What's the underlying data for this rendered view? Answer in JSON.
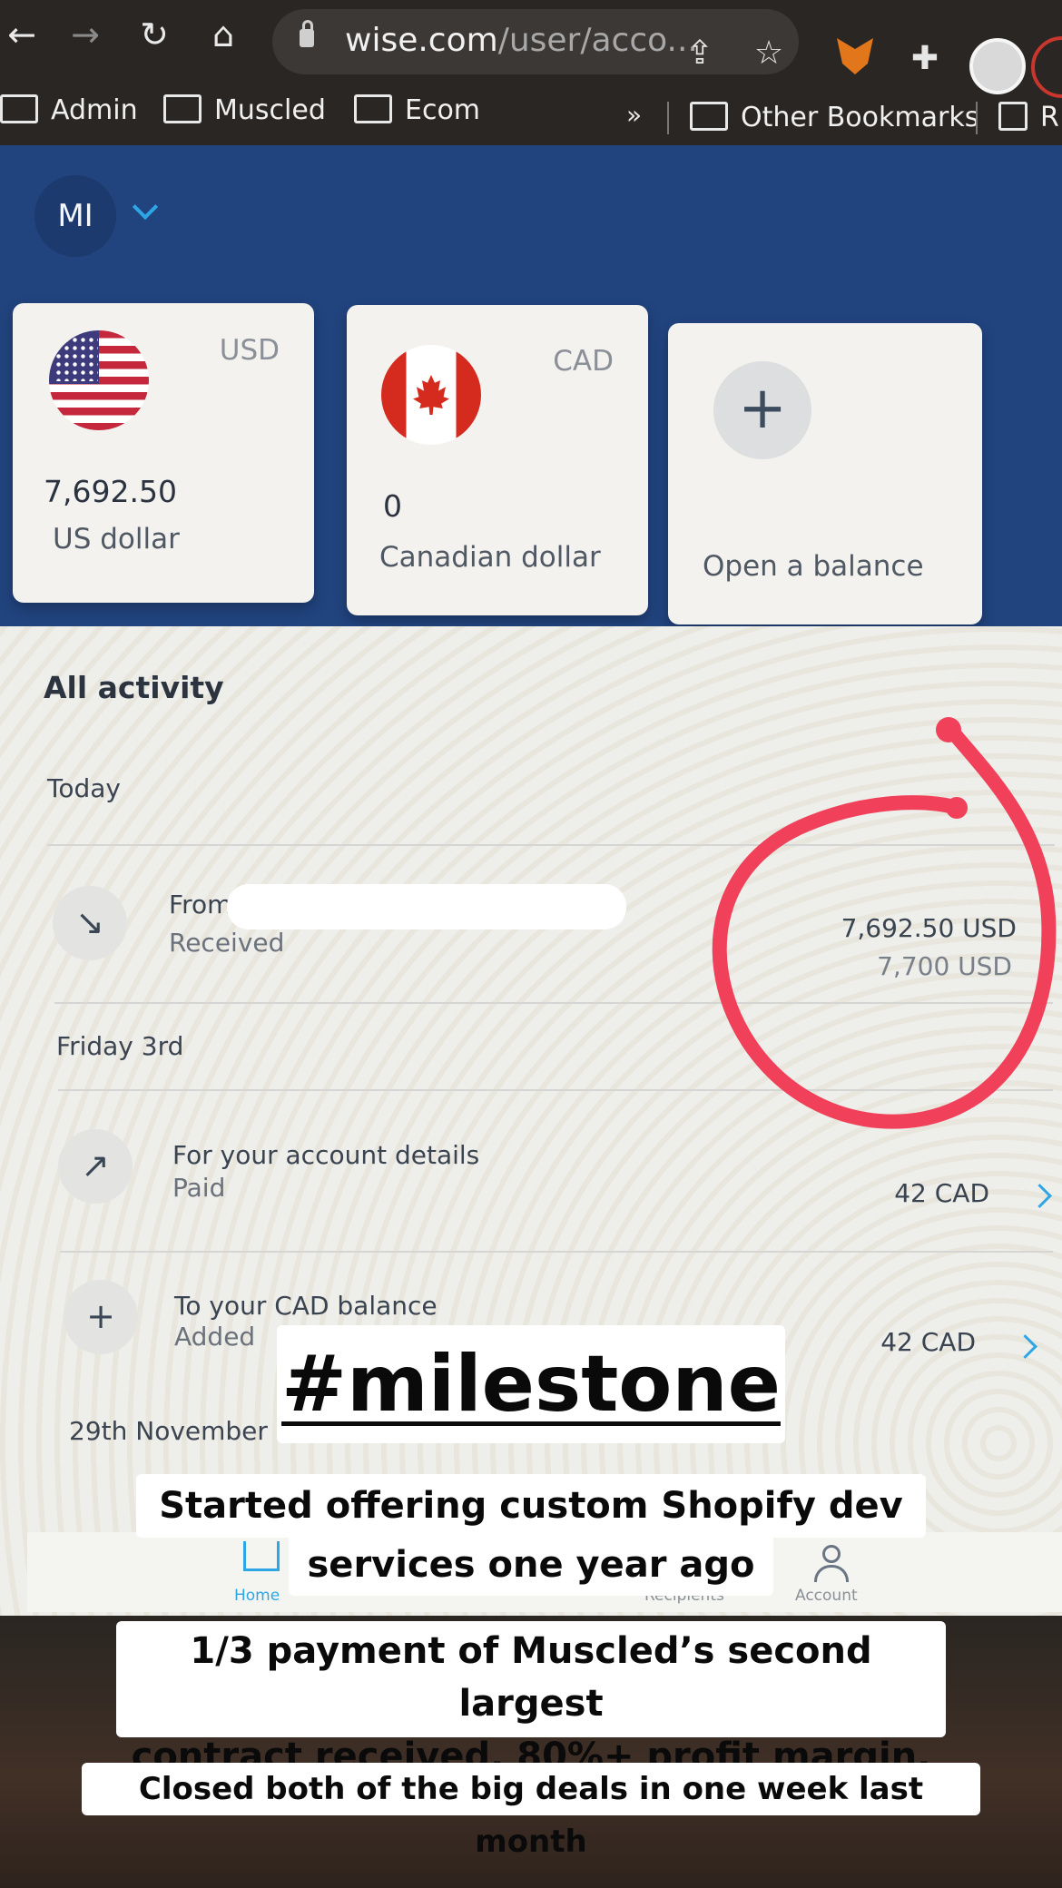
{
  "browser": {
    "url_host": "wise.com",
    "url_path": "/user/acco...",
    "bookmarks": [
      "Admin",
      "Muscled",
      "Ecom"
    ],
    "overflow": "»",
    "other_bookmarks": "Other Bookmarks",
    "reading_list_partial": "R"
  },
  "header": {
    "avatar_initials": "MI"
  },
  "balances": [
    {
      "code": "USD",
      "amount": "7,692.50",
      "name": "US dollar",
      "flag": "us-flag"
    },
    {
      "code": "CAD",
      "amount": "0",
      "name": "Canadian dollar",
      "flag": "canada-flag"
    }
  ],
  "open_balance": {
    "label": "Open a balance",
    "icon": "+"
  },
  "activity": {
    "title": "All activity",
    "sections": [
      {
        "label": "Today",
        "items": [
          {
            "title": "From",
            "status": "Received",
            "amount": "7,692.50 USD",
            "amount_secondary": "7,700 USD",
            "icon": "↘"
          }
        ]
      },
      {
        "label": "Friday 3rd",
        "items": [
          {
            "title": "For your account details",
            "status": "Paid",
            "amount": "42 CAD",
            "icon": "↗"
          },
          {
            "title": "To your CAD balance",
            "status": "Added",
            "amount": "42 CAD",
            "icon": "+"
          }
        ]
      },
      {
        "label": "29th November",
        "items": []
      }
    ]
  },
  "bottom_nav": {
    "home": "Home",
    "recipients": "Recipients",
    "account": "Account"
  },
  "story": {
    "hashtag": "#milestone",
    "line1a": "Started offering custom Shopify dev",
    "line1b": "services one year ago",
    "line2a": "1/3 payment of Muscled’s second largest",
    "line2b": "contract received. 80%+ profit margin.",
    "line3": "Closed both of the big deals in one week last month"
  },
  "colors": {
    "wise_navy": "#21437e",
    "accent_blue": "#2ea6e6",
    "annotation_red": "#f0405a"
  }
}
